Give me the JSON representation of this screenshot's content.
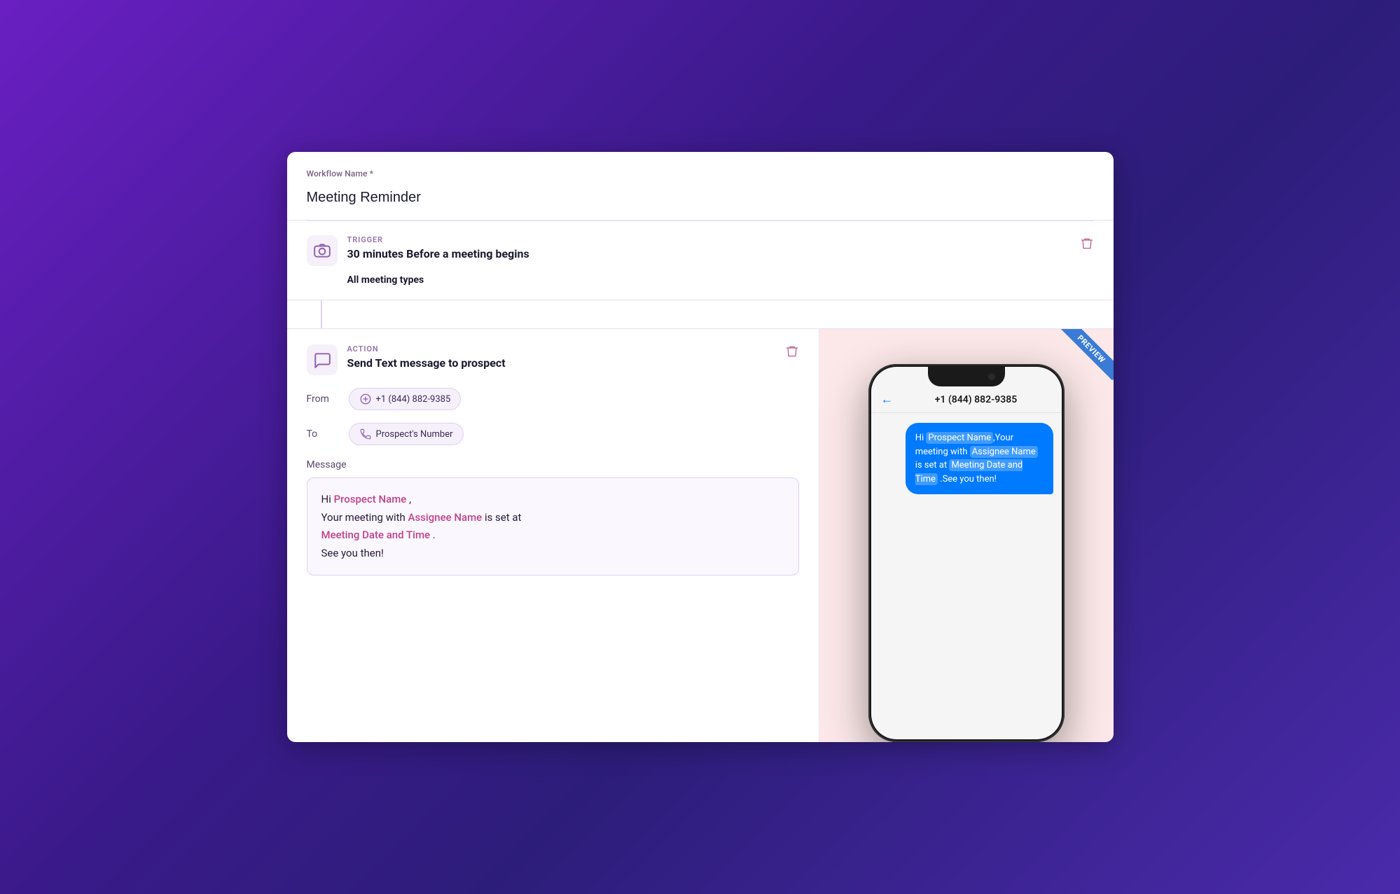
{
  "workflow": {
    "name_label": "Workflow Name *",
    "name_value": "Meeting Reminder"
  },
  "trigger": {
    "type_label": "TRIGGER",
    "title": "30 minutes Before a meeting begins",
    "subtitle": "All meeting types"
  },
  "action": {
    "type_label": "ACTION",
    "title": "Send Text message to prospect",
    "from_label": "From",
    "from_number": "+1 (844) 882-9385",
    "to_label": "To",
    "to_value": "Prospect's Number",
    "message_label": "Message",
    "message_text_hi": "Hi ",
    "prospect_name_var": "Prospect Name",
    "message_text_mid": ", ",
    "message_line2_prefix": "Your meeting with ",
    "assignee_name_var": "Assignee Name",
    "message_line2_suffix": " is set at",
    "meeting_datetime_var": "Meeting Date and Time",
    "message_line3": " .",
    "message_line4": "See you then!"
  },
  "preview": {
    "badge_text": "PREVIEW",
    "phone_number": "+1 (844) 882-9385",
    "bubble_hi": "Hi ",
    "bubble_prospect": "Prospect Name",
    "bubble_mid1": ",Your meeting with ",
    "bubble_assignee": "Assignee Name",
    "bubble_mid2": " is set at ",
    "bubble_datetime": "Meeting Date and Time",
    "bubble_end": " .See you then!"
  }
}
